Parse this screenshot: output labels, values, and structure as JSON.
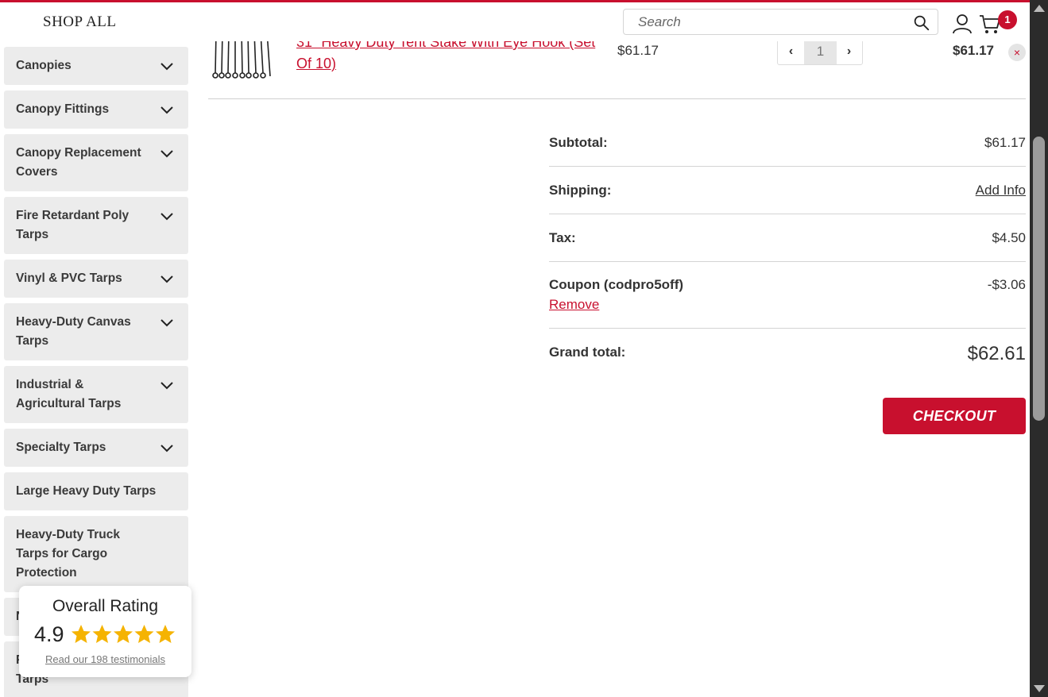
{
  "header": {
    "shop_all_label": "SHOP ALL",
    "search_placeholder": "Search",
    "cart_count": "1",
    "accent_color": "#c8102e"
  },
  "sidebar": {
    "items": [
      {
        "label": "Canopies",
        "expandable": true
      },
      {
        "label": "Canopy Fittings",
        "expandable": true
      },
      {
        "label": "Canopy Replacement Covers",
        "expandable": true
      },
      {
        "label": "Fire Retardant Poly Tarps",
        "expandable": true
      },
      {
        "label": "Vinyl & PVC Tarps",
        "expandable": true
      },
      {
        "label": "Heavy-Duty Canvas Tarps",
        "expandable": true
      },
      {
        "label": "Industrial & Agricultural Tarps",
        "expandable": true
      },
      {
        "label": "Specialty Tarps",
        "expandable": true
      },
      {
        "label": "Large Heavy Duty Tarps",
        "expandable": false
      },
      {
        "label": "Heavy-Duty Truck Tarps for Cargo Protection",
        "expandable": false
      },
      {
        "label": "N",
        "expandable": true
      },
      {
        "label": "F Tarps",
        "expandable": true
      }
    ]
  },
  "cart_item": {
    "title": "31\" Heavy Duty Tent Stake With Eye Hook (Set Of 10)",
    "price": "$61.17",
    "quantity": "1",
    "total": "$61.17",
    "remove_icon": "×"
  },
  "totals": {
    "subtotal_label": "Subtotal:",
    "subtotal_value": "$61.17",
    "shipping_label": "Shipping:",
    "shipping_value": "Add Info",
    "tax_label": "Tax:",
    "tax_value": "$4.50",
    "coupon_label": "Coupon (codpro5off)",
    "coupon_value": "-$3.06",
    "coupon_remove": "Remove",
    "grand_label": "Grand total:",
    "grand_value": "$62.61"
  },
  "checkout_label": "CHECKOUT",
  "rating_widget": {
    "title": "Overall Rating",
    "score": "4.9",
    "stars": 5,
    "link": "Read our 198 testimonials"
  }
}
